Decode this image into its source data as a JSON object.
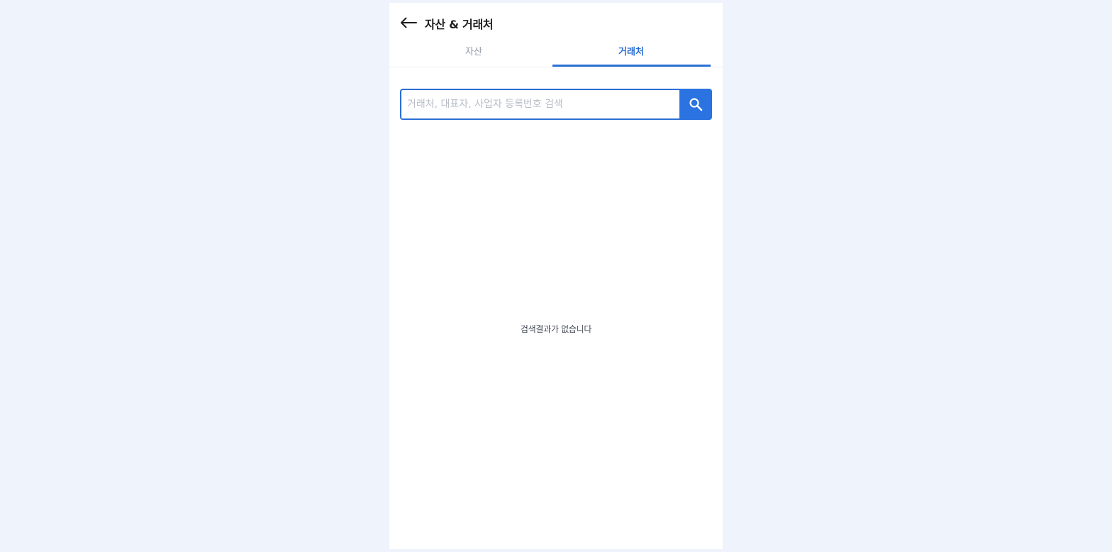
{
  "header": {
    "back_icon": "arrow-left-icon",
    "title": "자산 & 거래처"
  },
  "tabs": [
    {
      "label": "자산",
      "active": false
    },
    {
      "label": "거래처",
      "active": true
    }
  ],
  "search": {
    "value": "",
    "placeholder": "거래처, 대표자, 사업자 등록번호 검색",
    "button_icon": "search-icon"
  },
  "results": {
    "empty_message": "검색결과가 없습니다"
  },
  "colors": {
    "accent": "#2a6fd6",
    "search_button": "#2a73e1",
    "page_background": "#eff3fb"
  }
}
